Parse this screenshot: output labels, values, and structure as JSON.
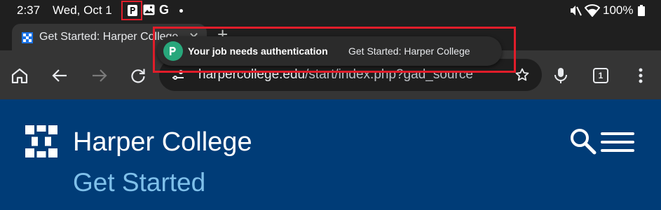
{
  "status_bar": {
    "time": "2:37",
    "date": "Wed, Oct 1",
    "battery": "100%",
    "icons": [
      "papercut-notification-icon",
      "gallery-icon",
      "google-icon",
      "more-dot-icon",
      "mute-icon",
      "wifi-icon",
      "battery-icon"
    ],
    "google_letter": "G"
  },
  "tab": {
    "title": "Get Started: Harper College",
    "close_label": "✕",
    "new_tab_label": "+"
  },
  "toolbar": {
    "url_domain": "harpercollege.edu",
    "url_path": "/start/index.php?gad_source",
    "tab_count": "1"
  },
  "page": {
    "brand": "Harper College",
    "subtitle": "Get Started",
    "colors": {
      "background": "#003c77",
      "subtitle": "#7fc0ea"
    }
  },
  "notification": {
    "title": "Your job needs authentication",
    "body": "Get Started: Harper College",
    "icon_color": "#28a77b",
    "highlight_color": "#e11d2a"
  }
}
